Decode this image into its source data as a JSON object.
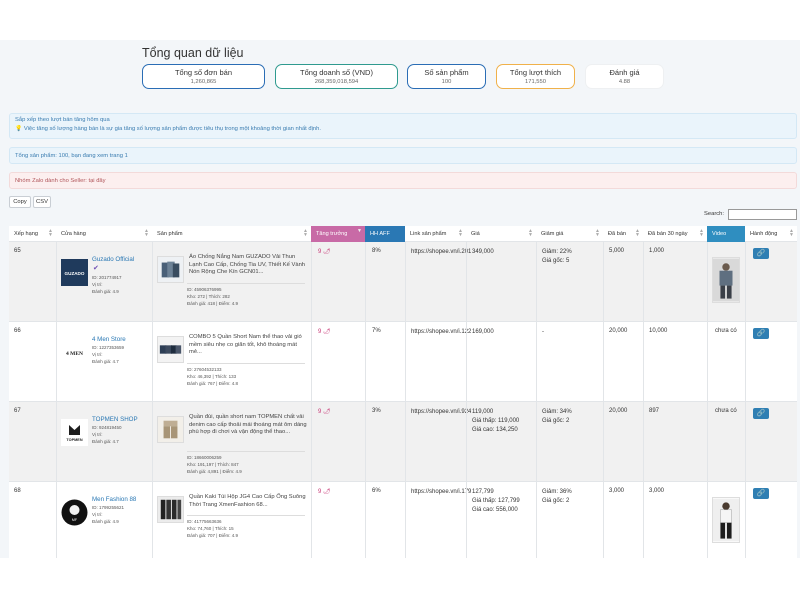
{
  "overview": {
    "title": "Tổng quan dữ liệu",
    "stats": [
      {
        "label": "Tổng số đơn bán",
        "value": "1,260,865"
      },
      {
        "label": "Tổng doanh số (VND)",
        "value": "268,359,018,594"
      },
      {
        "label": "Số sản phẩm",
        "value": "100"
      },
      {
        "label": "Tổng lượt thích",
        "value": "171,550"
      },
      {
        "label": "Đánh giá",
        "value": "4.88"
      }
    ]
  },
  "notices": {
    "sort_line1": "Sắp xếp theo lượt bán tăng hôm qua",
    "sort_line2": "💡 Việc tăng số lượng hàng bán là sự gia tăng số lượng sản phẩm được tiêu thụ trong một khoảng thời gian nhất định.",
    "total": "Tổng sản phẩm: 100, bạn đang xem trang 1",
    "zalo": "Nhóm Zalo dành cho Seller: tại đây"
  },
  "toolbar": {
    "copy": "Copy",
    "csv": "CSV",
    "search_label": "Search:"
  },
  "table": {
    "headers": [
      "Xếp hạng",
      "Cửa hàng",
      "Sản phẩm",
      "Tăng trưởng",
      "HH AFF",
      "Link sản phẩm",
      "Giá",
      "Giảm giá",
      "Đã bán",
      "Đã bán 30 ngày",
      "Video",
      "Hành động"
    ],
    "rows": [
      {
        "rank": "65",
        "shop": {
          "name": "Guzado Official",
          "logo_text": "GUZADO",
          "id": "ID: 201774917",
          "location": "Vị trí:",
          "rating": "Đánh giá: 4.9"
        },
        "product": {
          "title": "Áo Chống Nắng Nam GUZADO Vải Thun Lạnh Cao Cấp, Chống Tia UV, Thiết Kế Vành Nón Rộng Che Kín GCN01...",
          "id": "ID: 45906376995",
          "stock": "Kho: 272 | Thích: 282",
          "rating": "Đánh giá: 418 | Điểm: 4.9"
        },
        "growth": "9 🌶",
        "aff": "8%",
        "link": "https://shopee.vn/i.201774917.45906376995",
        "price": [
          "349,000"
        ],
        "discount": [
          "Giảm: 22%",
          "Giá gốc: 5"
        ],
        "sold": "5,000",
        "sold30": "1,000",
        "video": "",
        "has_video": true
      },
      {
        "rank": "66",
        "shop": {
          "name": "4 Men Store",
          "logo_text": "4 MEN",
          "id": "ID: 1227353659",
          "location": "Vị trí:",
          "rating": "Đánh giá: 4.7"
        },
        "product": {
          "title": "COMBO 5 Quần Short Nam thể thao vải gió mềm siêu nhẹ co giãn tốt, khô thoáng mát mẻ...",
          "id": "ID: 27604532133",
          "stock": "Kho: 46,392 | Thích: 133",
          "rating": "Đánh giá: 767 | Điểm: 4.8"
        },
        "growth": "9 🌶",
        "aff": "7%",
        "link": "https://shopee.vn/i.1227353659.27604532133",
        "price": [
          "169,000"
        ],
        "discount": [
          "-"
        ],
        "sold": "20,000",
        "sold30": "10,000",
        "video": "chưa có",
        "has_video": false
      },
      {
        "rank": "67",
        "shop": {
          "name": "TOPMEN SHOP",
          "logo_text": "TOPMEN",
          "id": "ID: 924819450",
          "location": "Vị trí:",
          "rating": "Đánh giá: 4.7"
        },
        "product": {
          "title": "Quần đùi, quần short nam TOPMEN chất vải denim cao cấp thoải mái thoáng mát ôm dáng phù hợp đi chơi và vận động thể thao...",
          "id": "ID: 18660006259",
          "stock": "Kho: 191,197 | Thích: 847",
          "rating": "Đánh giá: 4,891 | Điểm: 4.9"
        },
        "growth": "9 🌶",
        "aff": "3%",
        "link": "https://shopee.vn/i.924819450.18660006259",
        "price": [
          "119,000",
          "Giá thấp: 119,000",
          "Giá cao: 134,250"
        ],
        "discount": [
          "Giảm: 34%",
          "Giá gốc: 2"
        ],
        "sold": "20,000",
        "sold30": "897",
        "video": "chưa có",
        "has_video": false
      },
      {
        "rank": "68",
        "shop": {
          "name": "Men Fashion 88",
          "logo_text": "MF",
          "id": "ID: 1799255621",
          "location": "Vị trí:",
          "rating": "Đánh giá: 4.9"
        },
        "product": {
          "title": "Quần Kaki Túi Hộp JG4 Cao Cấp Ống Suông Thời Trang XmenFashion 68...",
          "id": "ID: 41775663636",
          "stock": "Kho: 74,760 | Thích: 15",
          "rating": "Đánh giá: 707 | Điểm: 4.9"
        },
        "growth": "9 🌶",
        "aff": "6%",
        "link": "https://shopee.vn/i.1799255621.41775663636",
        "price": [
          "127,799",
          "Giá thấp: 127,799",
          "Giá cao: 556,000"
        ],
        "discount": [
          "Giảm: 36%",
          "Giá gốc: 2"
        ],
        "sold": "3,000",
        "sold30": "3,000",
        "video": "",
        "has_video": true
      }
    ]
  }
}
